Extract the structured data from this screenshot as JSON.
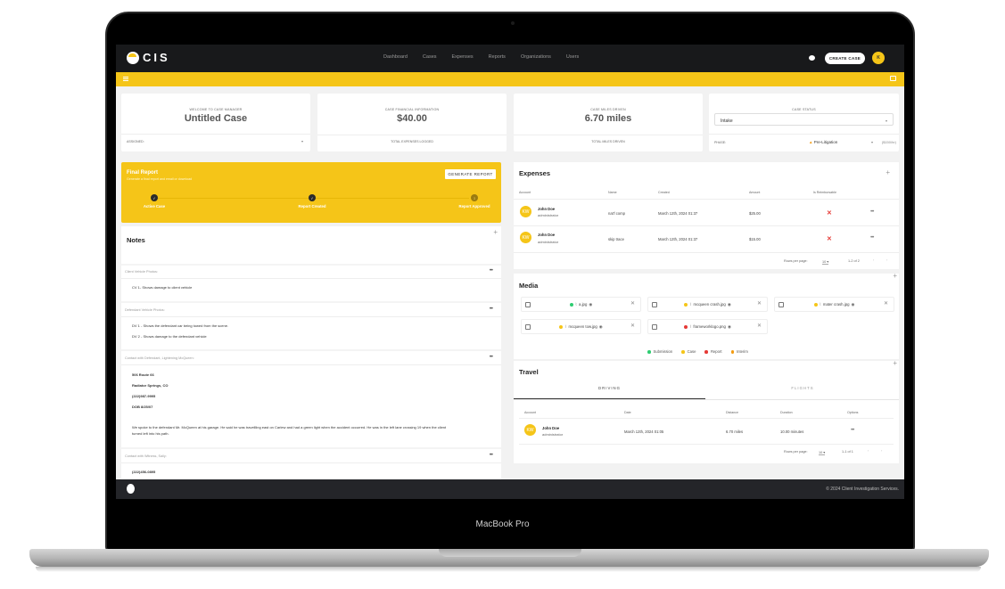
{
  "device": {
    "label": "MacBook Pro"
  },
  "topbar": {
    "logo_text": "CIS",
    "nav": [
      "Dashboard",
      "Cases",
      "Expenses",
      "Reports",
      "Organizations",
      "Users"
    ],
    "create_case_label": "CREATE CASE",
    "user_initial": "K"
  },
  "kpis": {
    "case": {
      "label": "Welcome to Case Manager",
      "value": "Untitled Case",
      "assigned_label": "Assigned:"
    },
    "financial": {
      "label": "Case Financial Information",
      "value": "$40.00",
      "foot": "Total Expenses Logged"
    },
    "miles": {
      "label": "Case Miles Driven",
      "value": "6.70 miles",
      "foot": "Total Miles Driven"
    },
    "status": {
      "label": "Case Status",
      "selected": "Intake",
      "phase_label": "Phase:",
      "phase_value": "Pre-Litigation",
      "phase_rate": "($150/hr)"
    }
  },
  "final_report": {
    "title": "Final Report",
    "subtitle": "Generate a final report and email or download",
    "button": "GENERATE REPORT",
    "steps": [
      {
        "label": "Active Case",
        "state": "done",
        "mark": "✓"
      },
      {
        "label": "Report Created",
        "state": "done",
        "mark": "✓"
      },
      {
        "label": "Report Approved",
        "state": "pending",
        "mark": "3"
      }
    ]
  },
  "notes": {
    "title": "Notes",
    "items": [
      {
        "heading": "Client Vehicle Photos:",
        "lines": [
          "CV 1- Shows damage to client vehicle"
        ]
      },
      {
        "heading": "Defendant Vehicle Photos:",
        "lines": [
          "DV 1 - Shows the defendant car being towed from the scene.",
          "DV 2 - Shows damage to the defendant vehicle"
        ]
      },
      {
        "heading": "Contact with Defendant, Lightening McQueen:",
        "lines": [
          "506 Route 66",
          "Radiator Springs, CO",
          "(222)987-9995",
          "DOB 8/25/07",
          "We spoke to the defendant Mr. McQueen at his garage. He said he was travellling east on Carlew and had a green light when the accident occurred. He was in the left lane crossing 19 when the client",
          "turned left into his path."
        ]
      },
      {
        "heading": "Contact with Witness, Sally:",
        "lines": [
          "(222)456-0895"
        ]
      }
    ]
  },
  "expenses": {
    "title": "Expenses",
    "columns": [
      "Account",
      "Name",
      "Created",
      "Amount",
      "Is Reimbursable"
    ],
    "rows": [
      {
        "initials": "KW",
        "account": "John Doe",
        "role": "administrator",
        "name": "nat'l comp",
        "created": "March 12th, 2024 01:37",
        "amount": "$25.00",
        "reimbursable": "✕"
      },
      {
        "initials": "KW",
        "account": "John Doe",
        "role": "administrator",
        "name": "skip trace",
        "created": "March 12th, 2024 01:37",
        "amount": "$15.00",
        "reimbursable": "✕"
      }
    ],
    "rows_per_page_label": "Rows per page:",
    "rows_per_page": "10",
    "range": "1-2 of 2"
  },
  "media": {
    "title": "Media",
    "files": [
      {
        "name": "a.jpg",
        "color": "#2ecc71"
      },
      {
        "name": "mcqueen crash.jpg",
        "color": "#f5c518"
      },
      {
        "name": "mater crash.jpg",
        "color": "#f5c518"
      },
      {
        "name": "mcqueen tow.jpg",
        "color": "#f5c518"
      },
      {
        "name": "frameworklogo.png",
        "color": "#e53935"
      }
    ],
    "legend": [
      {
        "label": "Submission",
        "color": "#2ecc71"
      },
      {
        "label": "Case",
        "color": "#f5c518"
      },
      {
        "label": "Report",
        "color": "#e53935"
      },
      {
        "label": "Interim",
        "color": "#f39c12"
      }
    ]
  },
  "travel": {
    "title": "Travel",
    "tabs": [
      "DRIVING",
      "FLIGHTS"
    ],
    "columns": [
      "Account",
      "Date",
      "Distance",
      "Duration",
      "Options"
    ],
    "rows": [
      {
        "initials": "KW",
        "account": "John Doe",
        "role": "administrator",
        "date": "March 12th, 2024 01:05",
        "distance": "6.70 miles",
        "duration": "10.00 minutes"
      }
    ],
    "rows_per_page_label": "Rows per page:",
    "rows_per_page": "10",
    "range": "1-1 of 1"
  },
  "footer": {
    "copyright": "© 2024 Client Investigation Services."
  }
}
